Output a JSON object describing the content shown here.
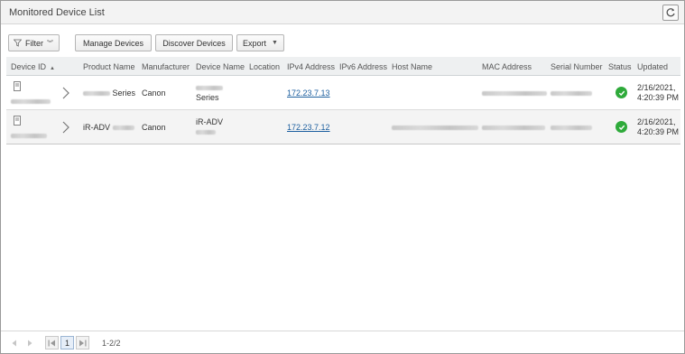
{
  "header": {
    "title": "Monitored Device List",
    "refresh_icon": "refresh-icon"
  },
  "toolbar": {
    "filter_label": "Filter",
    "manage_label": "Manage Devices",
    "discover_label": "Discover Devices",
    "export_label": "Export"
  },
  "table": {
    "columns": [
      "Device ID",
      "Product Name",
      "Manufacturer",
      "Device Name",
      "Location",
      "IPv4 Address",
      "IPv6 Address",
      "Host Name",
      "MAC Address",
      "Serial Number",
      "Status",
      "Updated"
    ],
    "sort_column": "Device ID",
    "rows": [
      {
        "product_suffix": "Series",
        "manufacturer": "Canon",
        "device_name_line2": "Series",
        "ipv4": "172.23.7.13",
        "status": "ok",
        "updated_date": "2/16/2021,",
        "updated_time": "4:20:39 PM"
      },
      {
        "product_prefix": "iR-ADV",
        "manufacturer": "Canon",
        "device_name_line1": "iR-ADV",
        "ipv4": "172.23.7.12",
        "status": "ok",
        "updated_date": "2/16/2021,",
        "updated_time": "4:20:39 PM"
      }
    ]
  },
  "pagination": {
    "current_page": "1",
    "range": "1-2/2"
  },
  "colors": {
    "status_ok": "#2eaa3a",
    "link": "#1d5f9f",
    "header_bg": "#f3f3f3"
  }
}
